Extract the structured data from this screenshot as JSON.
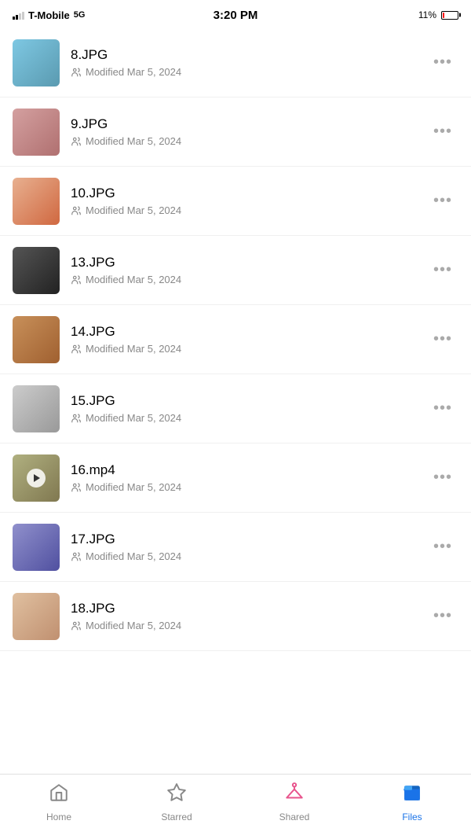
{
  "statusBar": {
    "carrier": "T-Mobile",
    "network": "5G",
    "time": "3:20 PM",
    "battery": "11%"
  },
  "files": [
    {
      "id": "8",
      "name": "8.JPG",
      "modified": "Modified Mar 5, 2024",
      "type": "image",
      "thumbClass": "thumb-8"
    },
    {
      "id": "9",
      "name": "9.JPG",
      "modified": "Modified Mar 5, 2024",
      "type": "image",
      "thumbClass": "thumb-9"
    },
    {
      "id": "10",
      "name": "10.JPG",
      "modified": "Modified Mar 5, 2024",
      "type": "image",
      "thumbClass": "thumb-10"
    },
    {
      "id": "13",
      "name": "13.JPG",
      "modified": "Modified Mar 5, 2024",
      "type": "image",
      "thumbClass": "thumb-13"
    },
    {
      "id": "14",
      "name": "14.JPG",
      "modified": "Modified Mar 5, 2024",
      "type": "image",
      "thumbClass": "thumb-14"
    },
    {
      "id": "15",
      "name": "15.JPG",
      "modified": "Modified Mar 5, 2024",
      "type": "image",
      "thumbClass": "thumb-15"
    },
    {
      "id": "16",
      "name": "16.mp4",
      "modified": "Modified Mar 5, 2024",
      "type": "video",
      "thumbClass": "thumb-16"
    },
    {
      "id": "17",
      "name": "17.JPG",
      "modified": "Modified Mar 5, 2024",
      "type": "image",
      "thumbClass": "thumb-17"
    },
    {
      "id": "18",
      "name": "18.JPG",
      "modified": "Modified Mar 5, 2024",
      "type": "image",
      "thumbClass": "thumb-18"
    }
  ],
  "bottomNav": {
    "items": [
      {
        "id": "home",
        "label": "Home",
        "active": false
      },
      {
        "id": "starred",
        "label": "Starred",
        "active": false
      },
      {
        "id": "shared",
        "label": "Shared",
        "active": false
      },
      {
        "id": "files",
        "label": "Files",
        "active": true
      }
    ]
  },
  "moreButtonLabel": "•••"
}
